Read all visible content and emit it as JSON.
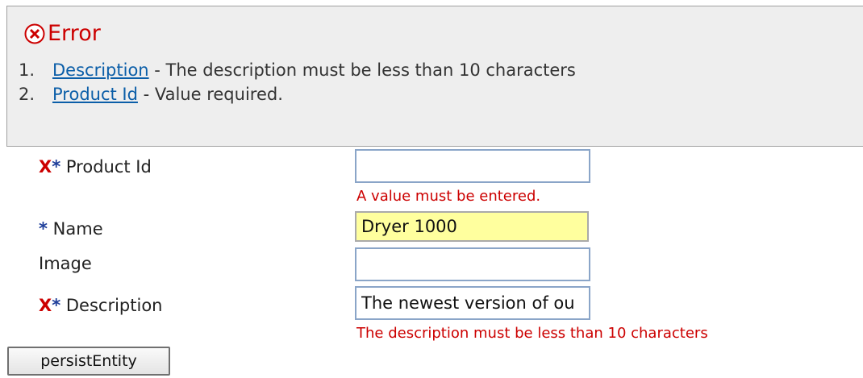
{
  "error_panel": {
    "title": "Error",
    "icon": "error-circle-icon",
    "items": [
      {
        "num": "1.",
        "link": "Description",
        "message": " - The description must be less than 10 characters"
      },
      {
        "num": "2.",
        "link": "Product Id",
        "message": " - Value required."
      }
    ]
  },
  "form": {
    "product_id": {
      "label": "Product Id",
      "value": "",
      "error": "A value must be entered.",
      "required": true,
      "invalid": true
    },
    "name": {
      "label": "Name",
      "value": "Dryer 1000",
      "required": true
    },
    "image": {
      "label": "Image",
      "value": ""
    },
    "description": {
      "label": "Description",
      "value": "The newest version of ou",
      "error": "The description must be less than 10 characters",
      "required": true,
      "invalid": true
    },
    "invalid_marker": "X",
    "required_marker": "*"
  },
  "actions": {
    "submit_label": "persistEntity"
  },
  "colors": {
    "error": "#cc0000",
    "link": "#0b5ea8",
    "required": "#1e3e9a",
    "highlight_field": "#ffff9e",
    "panel_bg": "#eeeeee"
  }
}
